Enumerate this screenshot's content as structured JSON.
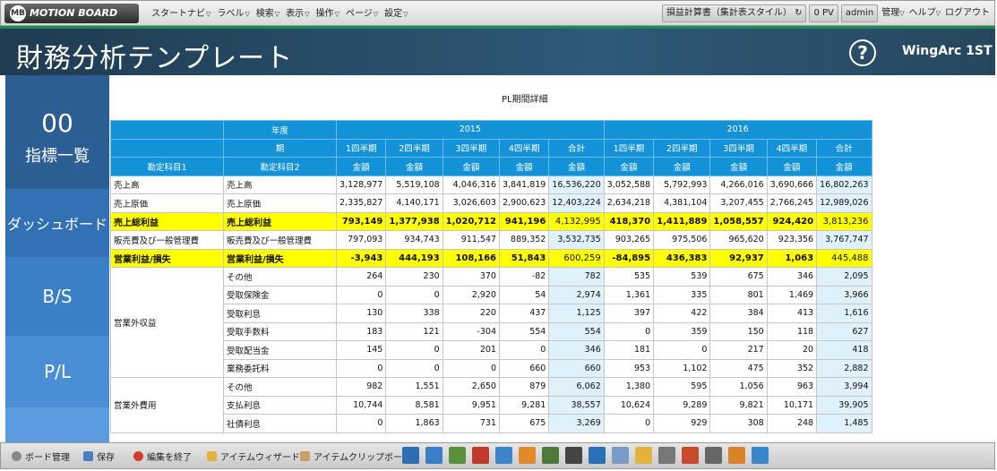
{
  "app": {
    "logo_text": "MOTION BOARD",
    "logo_badge": "MB"
  },
  "menu": [
    {
      "label": "スタートナビ"
    },
    {
      "label": "ラベル"
    },
    {
      "label": "検索"
    },
    {
      "label": "表示"
    },
    {
      "label": "操作"
    },
    {
      "label": "ページ"
    },
    {
      "label": "設定"
    }
  ],
  "topright": {
    "board_name": "損益計算書（集計表スタイル）",
    "pv": "0 PV",
    "user": "admin",
    "manage": "管理",
    "help": "ヘルプ",
    "logout": "ログアウト"
  },
  "header": {
    "title": "財務分析テンプレート",
    "help_glyph": "?",
    "brand": "WingArc 1ST"
  },
  "sidebar": {
    "items": [
      {
        "num": "00",
        "label": "指標一覧"
      },
      {
        "label": "ダッシュボード"
      },
      {
        "label": "B/S"
      },
      {
        "label": "P/L"
      }
    ]
  },
  "report": {
    "title": "PL期間詳細",
    "header": {
      "year_label": "年度",
      "period_label": "期",
      "acc1_label": "勘定科目1",
      "acc2_label": "勘定科目2",
      "years": [
        "2015",
        "2016"
      ],
      "periods": [
        "1四半期",
        "2四半期",
        "3四半期",
        "4四半期",
        "合計",
        "1四半期",
        "2四半期",
        "3四半期",
        "4四半期",
        "合計"
      ],
      "measure": "金額"
    },
    "rows": [
      {
        "acc1": "売上高",
        "acc2": "売上高",
        "values": [
          "3,128,977",
          "5,519,108",
          "4,046,316",
          "3,841,819",
          "16,536,220",
          "3,052,588",
          "5,792,993",
          "4,266,016",
          "3,690,666",
          "16,802,263"
        ]
      },
      {
        "acc1": "売上原価",
        "acc2": "売上原価",
        "values": [
          "2,335,827",
          "4,140,171",
          "3,026,603",
          "2,900,623",
          "12,403,224",
          "2,634,218",
          "4,381,104",
          "3,207,455",
          "2,766,245",
          "12,989,026"
        ]
      },
      {
        "acc1": "売上総利益",
        "acc2": "売上総利益",
        "highlight": true,
        "values": [
          "793,149",
          "1,377,938",
          "1,020,712",
          "941,196",
          "4,132,995",
          "418,370",
          "1,411,889",
          "1,058,557",
          "924,420",
          "3,813,236"
        ]
      },
      {
        "acc1": "販売費及び一般管理費",
        "acc2": "販売費及び一般管理費",
        "values": [
          "797,093",
          "934,743",
          "911,547",
          "889,352",
          "3,532,735",
          "903,265",
          "975,506",
          "965,620",
          "923,356",
          "3,767,747"
        ]
      },
      {
        "acc1": "営業利益/損失",
        "acc2": "営業利益/損失",
        "highlight": true,
        "values": [
          "-3,943",
          "444,193",
          "108,166",
          "51,843",
          "600,259",
          "-84,895",
          "436,383",
          "92,937",
          "1,063",
          "445,488"
        ]
      }
    ],
    "group_nonop_income": {
      "acc1": "営業外収益",
      "rows": [
        {
          "acc2": "その他",
          "values": [
            "264",
            "230",
            "370",
            "-82",
            "782",
            "535",
            "539",
            "675",
            "346",
            "2,095"
          ]
        },
        {
          "acc2": "受取保険金",
          "values": [
            "0",
            "0",
            "2,920",
            "54",
            "2,974",
            "1,361",
            "335",
            "801",
            "1,469",
            "3,966"
          ]
        },
        {
          "acc2": "受取利息",
          "values": [
            "130",
            "338",
            "220",
            "437",
            "1,125",
            "397",
            "422",
            "384",
            "413",
            "1,616"
          ]
        },
        {
          "acc2": "受取手数料",
          "values": [
            "183",
            "121",
            "-304",
            "554",
            "554",
            "0",
            "359",
            "150",
            "118",
            "627"
          ]
        },
        {
          "acc2": "受取配当金",
          "values": [
            "145",
            "0",
            "201",
            "0",
            "346",
            "181",
            "0",
            "217",
            "20",
            "418"
          ]
        },
        {
          "acc2": "業務委託料",
          "values": [
            "0",
            "0",
            "0",
            "660",
            "660",
            "953",
            "1,102",
            "475",
            "352",
            "2,882"
          ]
        }
      ]
    },
    "group_nonop_expense": {
      "acc1": "営業外費用",
      "rows": [
        {
          "acc2": "その他",
          "values": [
            "982",
            "1,551",
            "2,650",
            "879",
            "6,062",
            "1,380",
            "595",
            "1,056",
            "963",
            "3,994"
          ]
        },
        {
          "acc2": "支払利息",
          "values": [
            "10,744",
            "8,581",
            "9,951",
            "9,281",
            "38,557",
            "10,624",
            "9,289",
            "9,821",
            "10,171",
            "39,905"
          ]
        },
        {
          "acc2": "社債利息",
          "values": [
            "0",
            "1,863",
            "731",
            "675",
            "3,269",
            "0",
            "929",
            "308",
            "248",
            "1,485"
          ]
        }
      ]
    }
  },
  "bottombar": {
    "board_manage": "ボード管理",
    "save": "保存",
    "end_edit": "編集を終了",
    "item_wizard": "アイテムウィザード",
    "item_clipboard": "アイテムクリップボード"
  },
  "tool_icons": [
    "layout-icon",
    "chart-icon",
    "grid-icon",
    "clock-icon",
    "image-icon",
    "scatter-icon",
    "panel-icon",
    "text-icon",
    "globe-icon",
    "comment-icon",
    "folder-icon",
    "input-icon",
    "shape-icon",
    "form-icon",
    "calendar-icon",
    "doc-icon"
  ],
  "colors": {
    "header_bg": "#1e3b51",
    "table_header": "#1392d8",
    "highlight": "#ffff00",
    "total_col": "#dff1fb"
  }
}
